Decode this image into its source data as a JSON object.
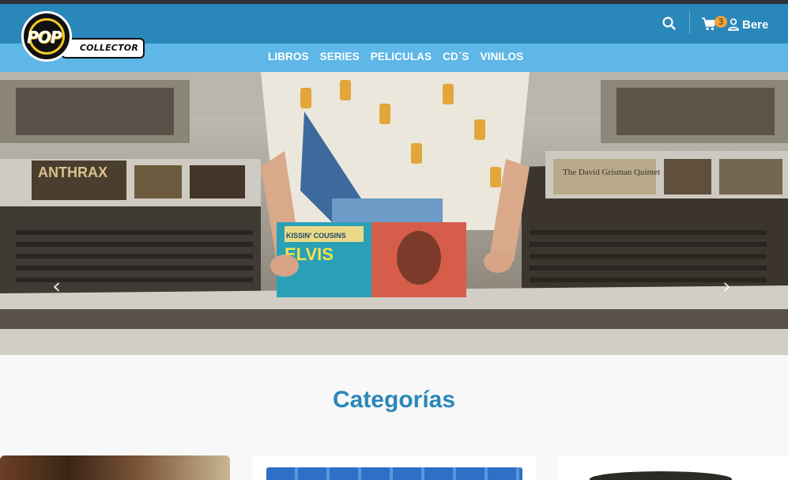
{
  "brand": {
    "logo_top": "POP",
    "logo_bottom": "COLLECTOR"
  },
  "header": {
    "cart_count": "3",
    "user_name": "Bere"
  },
  "nav": {
    "items": [
      "LIBROS",
      "SERIES",
      "PELICULAS",
      "CD´S",
      "VINILOS"
    ]
  },
  "hero": {
    "prev_symbol": "‹",
    "next_symbol": "›",
    "record_text": "ELVIS",
    "record_subtitle": "KISSIN' COUSINS",
    "bin_label_left": "ANTHRAX",
    "bin_label_right": "The David Grisman Quintet"
  },
  "categories": {
    "title": "Categorías"
  },
  "colors": {
    "header_bg": "#2a87ba",
    "nav_bg": "#5eb7e7",
    "accent": "#f4a237",
    "title": "#2a87ba"
  }
}
